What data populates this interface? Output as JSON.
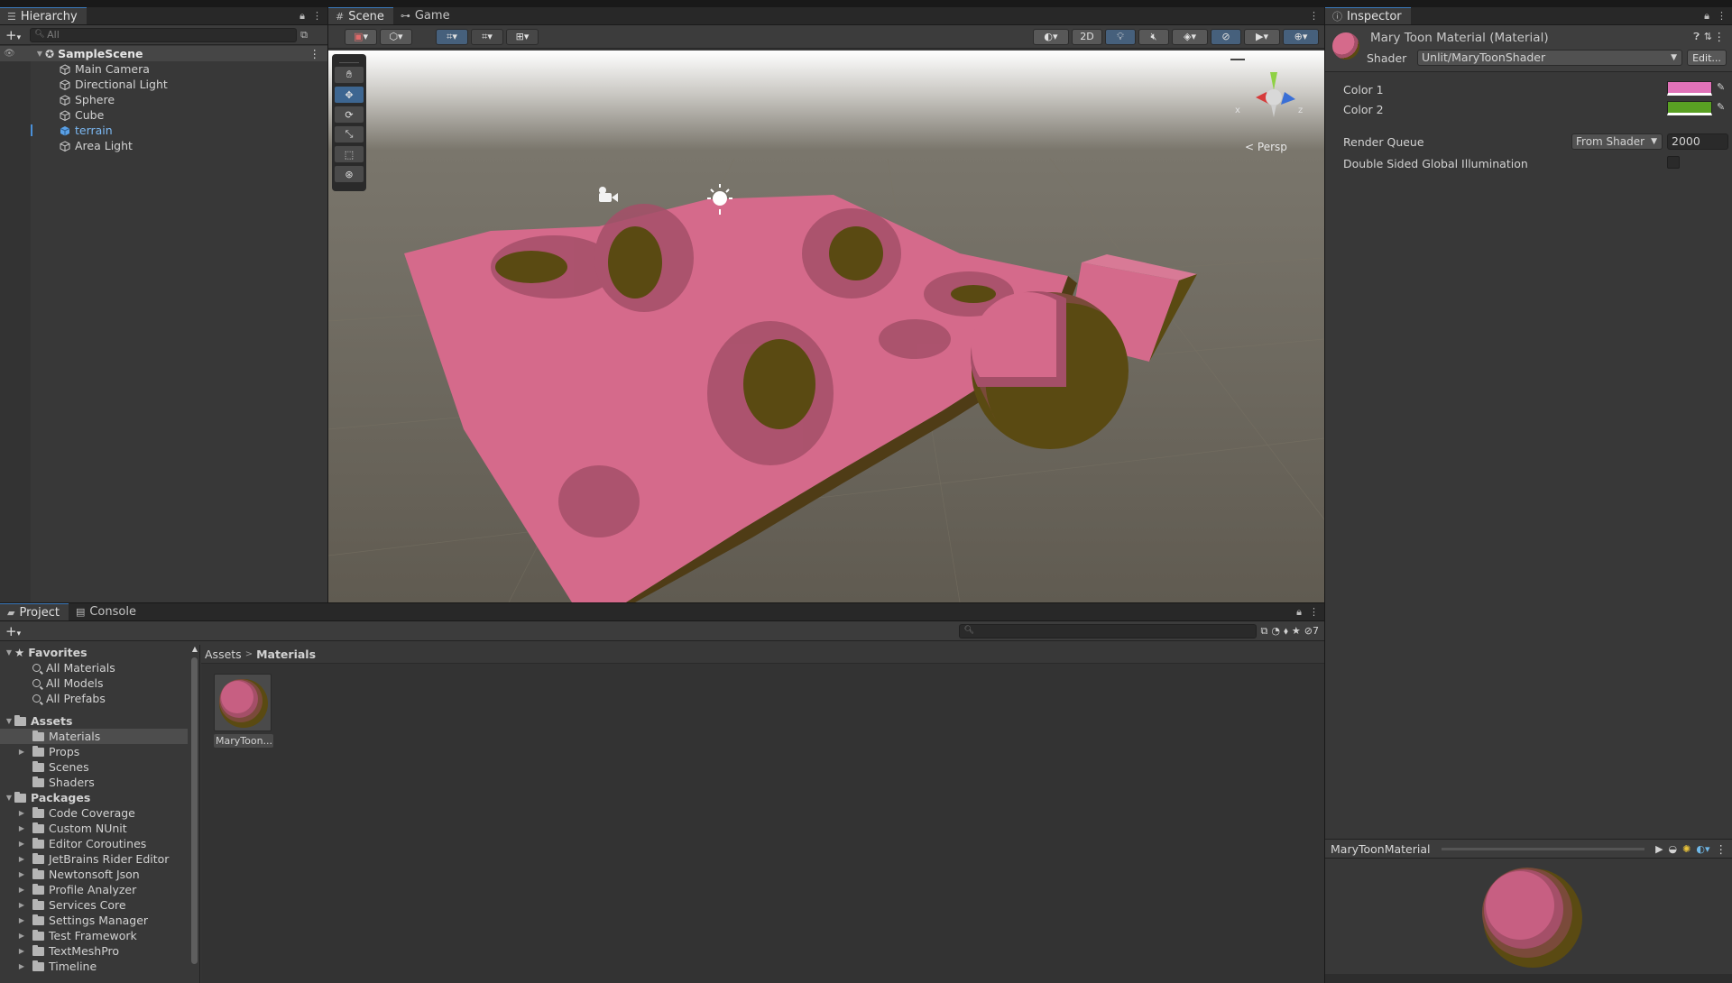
{
  "hierarchy": {
    "tab_label": "Hierarchy",
    "search_placeholder": "All",
    "scene_name": "SampleScene",
    "items": [
      {
        "label": "Main Camera"
      },
      {
        "label": "Directional Light"
      },
      {
        "label": "Sphere"
      },
      {
        "label": "Cube"
      },
      {
        "label": "terrain"
      },
      {
        "label": "Area Light"
      }
    ]
  },
  "scene_view": {
    "tabs": [
      {
        "label": "Scene"
      },
      {
        "label": "Game"
      }
    ],
    "toolbar_2d_label": "2D",
    "persp_label": "Persp",
    "gizmo_x": "x",
    "gizmo_z": "z",
    "colors": {
      "terrain": "#d5668a",
      "shade": "#5a4a12",
      "bg": "#686359"
    }
  },
  "inspector": {
    "tab_label": "Inspector",
    "material_title": "Mary Toon Material (Material)",
    "shader_label": "Shader",
    "shader_value": "Unlit/MaryToonShader",
    "edit_label": "Edit...",
    "color1_label": "Color 1",
    "color1_value": "#e072b8",
    "color2_label": "Color 2",
    "color2_value": "#59a023",
    "render_queue_label": "Render Queue",
    "render_queue_mode": "From Shader",
    "render_queue_value": "2000",
    "dsgi_label": "Double Sided Global Illumination",
    "preview_title": "MaryToonMaterial"
  },
  "project": {
    "tabs": [
      {
        "label": "Project"
      },
      {
        "label": "Console"
      }
    ],
    "hidden_count": "7",
    "breadcrumb": {
      "root": "Assets",
      "current": "Materials"
    },
    "favorites_label": "Favorites",
    "favorites": [
      {
        "label": "All Materials"
      },
      {
        "label": "All Models"
      },
      {
        "label": "All Prefabs"
      }
    ],
    "assets_label": "Assets",
    "assets": [
      {
        "label": "Materials"
      },
      {
        "label": "Props"
      },
      {
        "label": "Scenes"
      },
      {
        "label": "Shaders"
      }
    ],
    "packages_label": "Packages",
    "packages": [
      {
        "label": "Code Coverage"
      },
      {
        "label": "Custom NUnit"
      },
      {
        "label": "Editor Coroutines"
      },
      {
        "label": "JetBrains Rider Editor"
      },
      {
        "label": "Newtonsoft Json"
      },
      {
        "label": "Profile Analyzer"
      },
      {
        "label": "Services Core"
      },
      {
        "label": "Settings Manager"
      },
      {
        "label": "Test Framework"
      },
      {
        "label": "TextMeshPro"
      },
      {
        "label": "Timeline"
      }
    ],
    "grid_items": [
      {
        "label": "MaryToon..."
      }
    ]
  }
}
